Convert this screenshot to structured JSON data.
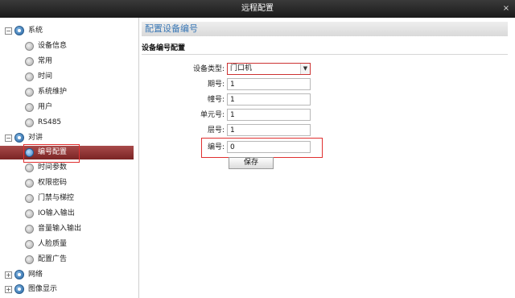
{
  "window": {
    "title": "远程配置",
    "close_glyph": "×"
  },
  "sidebar": {
    "groups": [
      {
        "label": "系统",
        "expander": "−",
        "icon": "settings-icon"
      },
      {
        "label": "对讲",
        "expander": "−",
        "icon": "settings-icon"
      },
      {
        "label": "网络",
        "expander": "+",
        "icon": "settings-icon"
      },
      {
        "label": "图像显示",
        "expander": "+",
        "icon": "settings-icon"
      }
    ],
    "system_items": [
      "设备信息",
      "常用",
      "时间",
      "系统维护",
      "用户",
      "RS485"
    ],
    "intercom_items": [
      "编号配置",
      "时间参数",
      "权限密码",
      "门禁与梯控",
      "IO输入输出",
      "音量输入输出",
      "人脸质量",
      "配置广告"
    ],
    "selected": "编号配置"
  },
  "main": {
    "section_title": "配置设备编号",
    "subsection_title": "设备编号配置",
    "fields": {
      "device_type": {
        "label": "设备类型:",
        "value": "门口机"
      },
      "period": {
        "label": "期号:",
        "value": "1"
      },
      "building": {
        "label": "幢号:",
        "value": "1"
      },
      "unit": {
        "label": "单元号:",
        "value": "1"
      },
      "floor": {
        "label": "层号:",
        "value": "1"
      },
      "number": {
        "label": "编号:",
        "value": "0"
      }
    },
    "save_label": "保存"
  },
  "colors": {
    "selected_bg": "#8f3333",
    "accent_red": "#e03030",
    "header_text": "#3b78b5"
  }
}
